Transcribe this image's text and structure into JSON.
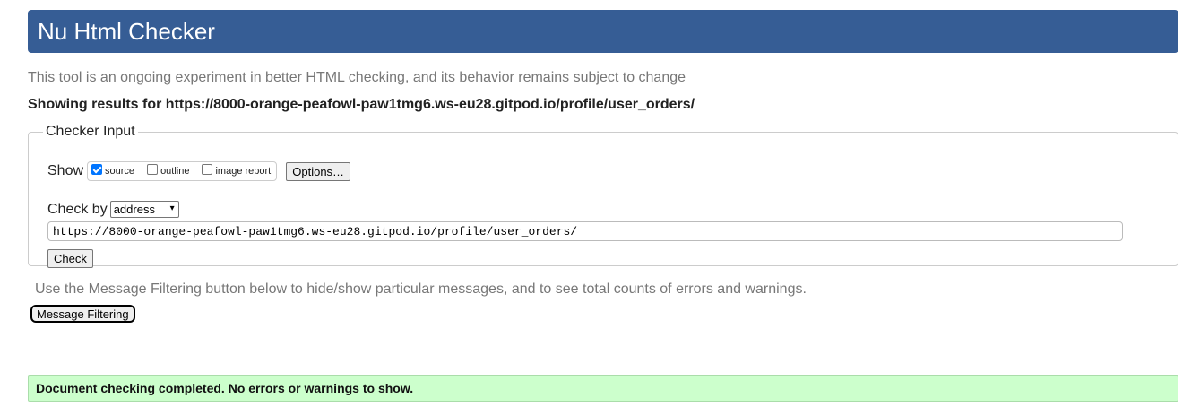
{
  "header": {
    "title": "Nu Html Checker"
  },
  "intro": {
    "subtitle": "This tool is an ongoing experiment in better HTML checking, and its behavior remains subject to change",
    "results_for": "Showing results for https://8000-orange-peafowl-paw1tmg6.ws-eu28.gitpod.io/profile/user_orders/"
  },
  "checker_input": {
    "legend": "Checker Input",
    "show_label": "Show",
    "show_options": [
      {
        "label": "source",
        "checked": true
      },
      {
        "label": "outline",
        "checked": false
      },
      {
        "label": "image report",
        "checked": false
      }
    ],
    "options_button": "Options…",
    "check_by_label": "Check by",
    "check_by_selected": "address",
    "url_value": "https://8000-orange-peafowl-paw1tmg6.ws-eu28.gitpod.io/profile/user_orders/",
    "check_button": "Check"
  },
  "filtering": {
    "note": "Use the Message Filtering button below to hide/show particular messages, and to see total counts of errors and warnings.",
    "button": "Message Filtering"
  },
  "result": {
    "message": "Document checking completed. No errors or warnings to show."
  },
  "colors": {
    "header_bg": "#365d95",
    "success_bg": "#ccffcc",
    "checkbox_checked": "#0075ff"
  }
}
